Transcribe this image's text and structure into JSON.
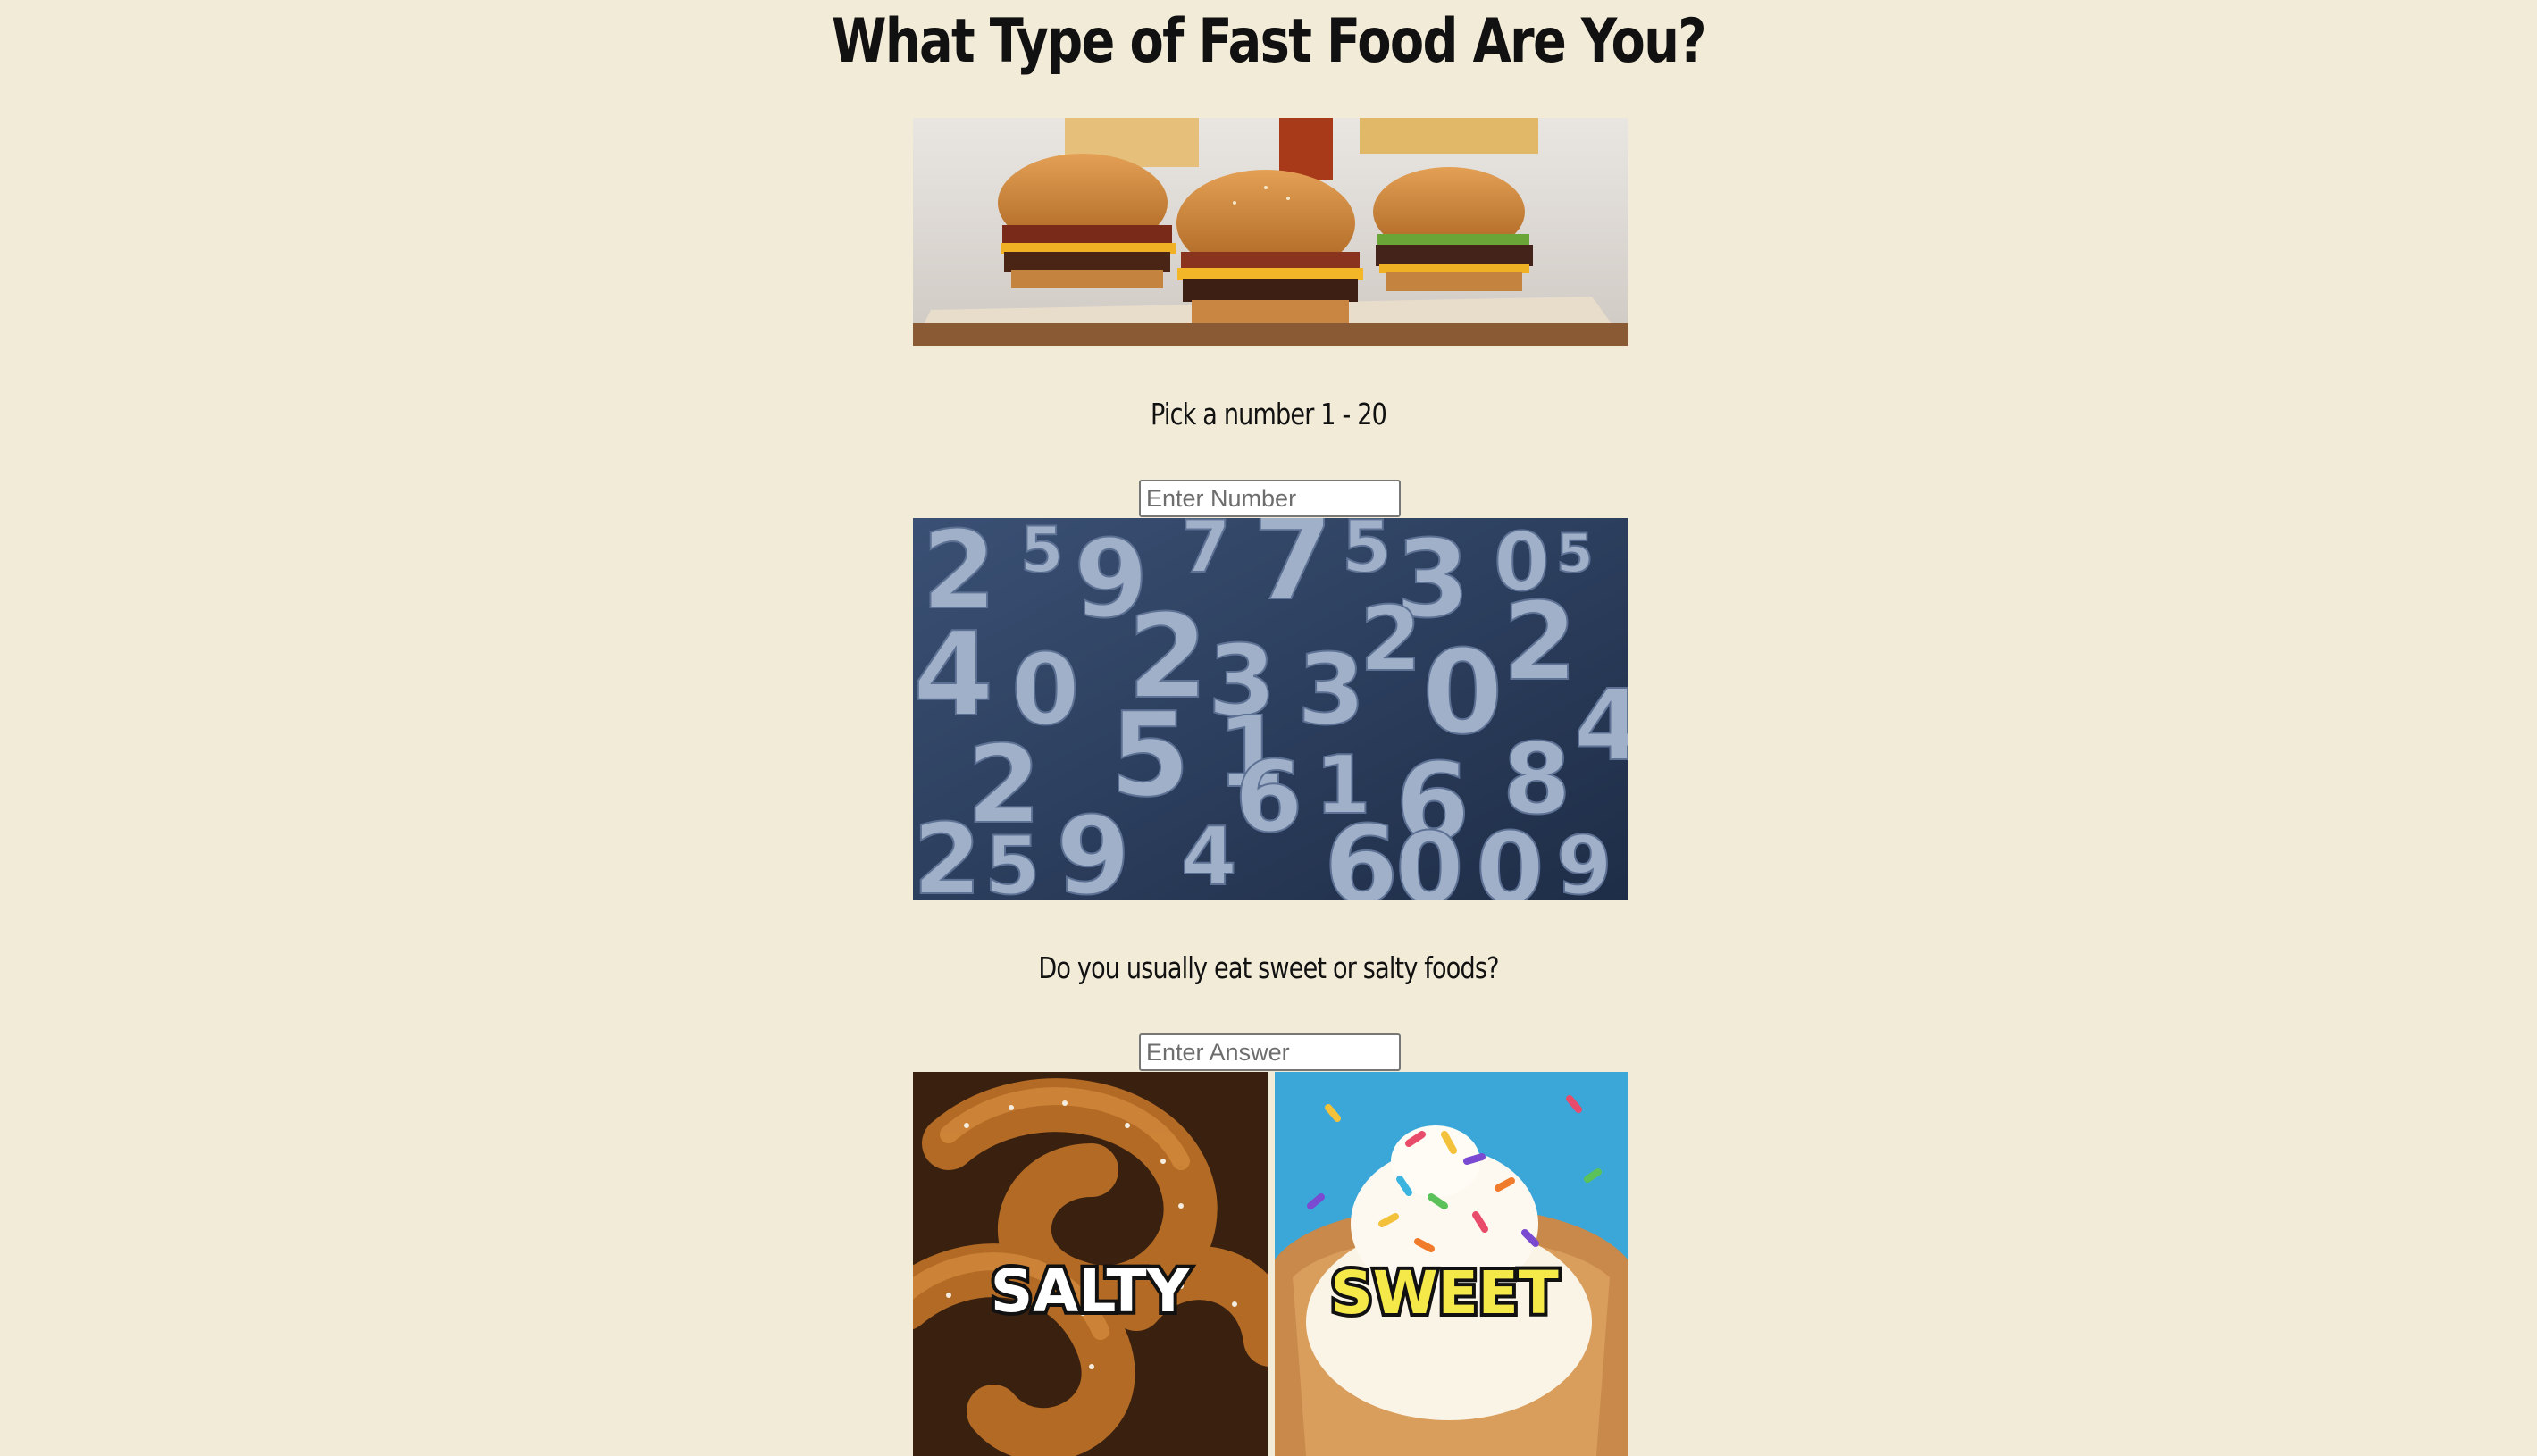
{
  "page": {
    "title": "What Type of Fast Food Are You?"
  },
  "hero_image": {
    "description": "burgers-and-fries"
  },
  "questions": [
    {
      "prompt": "Pick a number 1 - 20",
      "placeholder": "Enter Number",
      "value": ""
    },
    {
      "prompt": "Do you usually eat sweet or salty foods?",
      "placeholder": "Enter Answer",
      "value": ""
    }
  ],
  "choice_images": {
    "salty_label": "SALTY",
    "sweet_label": "SWEET"
  },
  "colors": {
    "background": "#f2ebd8",
    "numbers_bg": "#2b3e5f",
    "sweet_bg": "#3aa7d8",
    "sweet_text": "#f5e94a"
  }
}
